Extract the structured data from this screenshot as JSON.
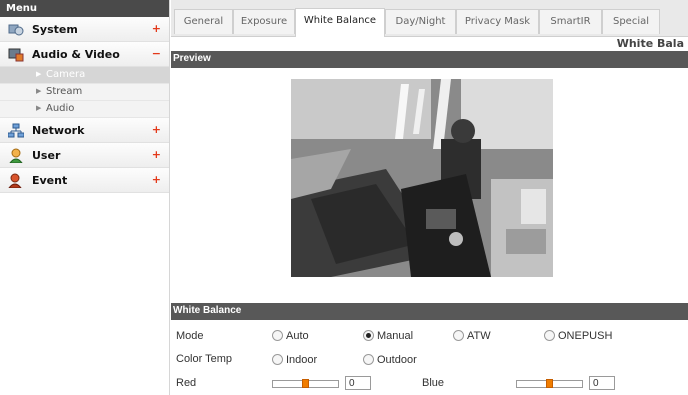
{
  "sidebar": {
    "header": "Menu",
    "categories": [
      {
        "label": "System",
        "toggle": "+"
      },
      {
        "label": "Audio & Video",
        "toggle": "−"
      },
      {
        "label": "Network",
        "toggle": "+"
      },
      {
        "label": "User",
        "toggle": "+"
      },
      {
        "label": "Event",
        "toggle": "+"
      }
    ],
    "audio_video_items": [
      {
        "label": "Camera",
        "active": true
      },
      {
        "label": "Stream"
      },
      {
        "label": "Audio"
      }
    ]
  },
  "tabs": [
    "General",
    "Exposure",
    "White Balance",
    "Day/Night",
    "Privacy Mask",
    "SmartIR",
    "Special"
  ],
  "active_tab": "White Balance",
  "page_heading": "White Bala",
  "preview": {
    "section_title": "Preview"
  },
  "white_balance": {
    "section_title": "White Balance",
    "mode": {
      "label": "Mode",
      "options": [
        "Auto",
        "Manual",
        "ATW",
        "ONEPUSH"
      ],
      "selected": "Manual"
    },
    "color_temp": {
      "label": "Color Temp",
      "options": [
        "Indoor",
        "Outdoor"
      ],
      "selected": null
    },
    "red": {
      "label": "Red",
      "value": "0"
    },
    "blue": {
      "label": "Blue",
      "value": "0"
    }
  },
  "colors": {
    "accent": "#f07d00",
    "toggle": "#e3391a",
    "section_bar": "#585858"
  }
}
